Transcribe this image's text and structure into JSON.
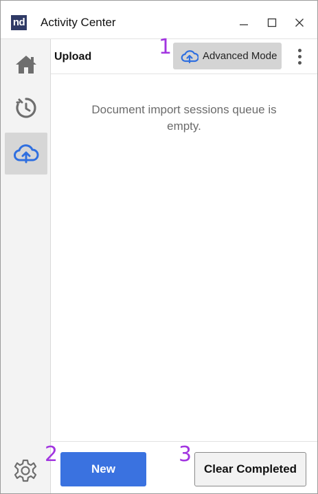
{
  "titlebar": {
    "logo_text": "nd",
    "title": "Activity Center",
    "icons": [
      "minimize-icon",
      "maximize-icon",
      "close-icon"
    ]
  },
  "sidebar": {
    "items": [
      {
        "name": "home",
        "icon": "home-icon",
        "active": false
      },
      {
        "name": "history",
        "icon": "history-icon",
        "active": false
      },
      {
        "name": "upload",
        "icon": "cloud-upload-icon",
        "active": true
      }
    ],
    "settings_icon": "gear-icon"
  },
  "toolbar": {
    "section_title": "Upload",
    "advanced_mode_label": "Advanced Mode",
    "more_icon": "more-vertical-icon"
  },
  "annotations": {
    "one": "1",
    "two": "2",
    "three": "3"
  },
  "main": {
    "empty_message": "Document import sessions queue is empty."
  },
  "footer": {
    "new_label": "New",
    "clear_completed_label": "Clear Completed"
  },
  "colors": {
    "accent_blue": "#3a72e0",
    "logo_bg": "#2f3a66",
    "annotation_purple": "#a235e0",
    "sidebar_bg": "#f3f3f3",
    "sidebar_active_bg": "#d6d6d6"
  }
}
